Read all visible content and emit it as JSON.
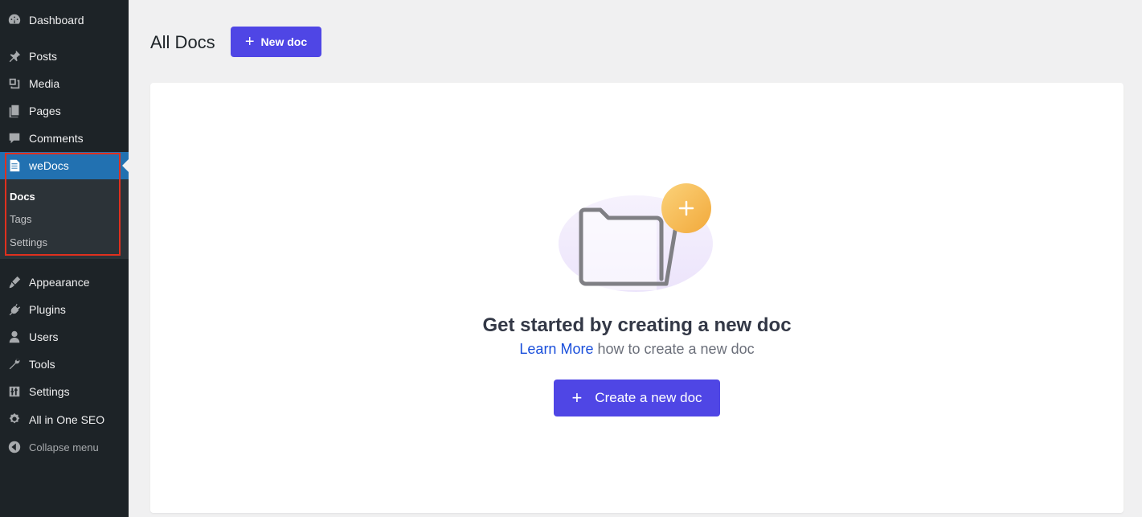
{
  "sidebar": {
    "items": [
      {
        "label": "Dashboard",
        "icon": "dashboard-icon"
      },
      {
        "label": "Posts",
        "icon": "pin-icon"
      },
      {
        "label": "Media",
        "icon": "media-icon"
      },
      {
        "label": "Pages",
        "icon": "pages-icon"
      },
      {
        "label": "Comments",
        "icon": "comment-icon"
      },
      {
        "label": "weDocs",
        "icon": "document-icon",
        "active": true
      },
      {
        "label": "Appearance",
        "icon": "brush-icon"
      },
      {
        "label": "Plugins",
        "icon": "plugin-icon"
      },
      {
        "label": "Users",
        "icon": "user-icon"
      },
      {
        "label": "Tools",
        "icon": "wrench-icon"
      },
      {
        "label": "Settings",
        "icon": "sliders-icon"
      },
      {
        "label": "All in One SEO",
        "icon": "seo-icon"
      }
    ],
    "submenu": [
      {
        "label": "Docs",
        "current": true
      },
      {
        "label": "Tags"
      },
      {
        "label": "Settings"
      }
    ],
    "collapse_label": "Collapse menu",
    "accent_color": "#2271b1",
    "highlight_color": "#e0301e"
  },
  "header": {
    "title": "All Docs",
    "new_doc_label": "New doc"
  },
  "empty_state": {
    "heading": "Get started by creating a new doc",
    "learn_more": "Learn More",
    "subtext": " how to create a new doc",
    "create_label": "Create a new doc",
    "button_color": "#4f46e5"
  }
}
